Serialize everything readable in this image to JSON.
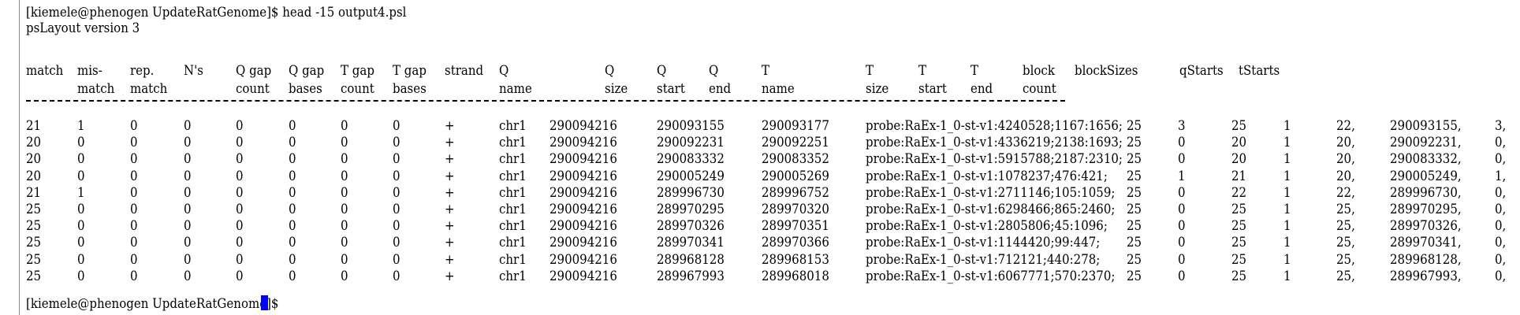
{
  "terminal": {
    "command_prompt": "[kiemele@phenogen UpdateRatGenome]$ head -15 output4.psl",
    "version_line": "psLayout version 3",
    "header_row1": [
      "match",
      "mis-",
      "rep.",
      "N's",
      "Q gap",
      "Q gap",
      "T gap",
      "T gap",
      "strand",
      "Q",
      "Q",
      "Q",
      "Q",
      "T",
      "T",
      "T",
      "T",
      "block",
      "blockSizes",
      "qStarts",
      "tStarts"
    ],
    "header_row2": [
      "",
      "match",
      "match",
      "",
      "count",
      "bases",
      "count",
      "bases",
      "",
      "name",
      "size",
      "start",
      "end",
      "name",
      "size",
      "start",
      "end",
      "count",
      "",
      "",
      ""
    ],
    "rows": [
      [
        "21",
        "1",
        "0",
        "0",
        "0",
        "0",
        "0",
        "0",
        "+",
        "chr1",
        "290094216",
        "290093155",
        "290093177",
        "probe:RaEx-1_0-st-v1:4240528;1167:1656;",
        "25",
        "3",
        "25",
        "1",
        "22,",
        "290093155,",
        "3,"
      ],
      [
        "20",
        "0",
        "0",
        "0",
        "0",
        "0",
        "0",
        "0",
        "+",
        "chr1",
        "290094216",
        "290092231",
        "290092251",
        "probe:RaEx-1_0-st-v1:4336219;2138:1693;",
        "25",
        "0",
        "20",
        "1",
        "20,",
        "290092231,",
        "0,"
      ],
      [
        "20",
        "0",
        "0",
        "0",
        "0",
        "0",
        "0",
        "0",
        "+",
        "chr1",
        "290094216",
        "290083332",
        "290083352",
        "probe:RaEx-1_0-st-v1:5915788;2187:2310;",
        "25",
        "0",
        "20",
        "1",
        "20,",
        "290083332,",
        "0,"
      ],
      [
        "20",
        "0",
        "0",
        "0",
        "0",
        "0",
        "0",
        "0",
        "+",
        "chr1",
        "290094216",
        "290005249",
        "290005269",
        "probe:RaEx-1_0-st-v1:1078237;476:421;",
        "25",
        "1",
        "21",
        "1",
        "20,",
        "290005249,",
        "1,"
      ],
      [
        "21",
        "1",
        "0",
        "0",
        "0",
        "0",
        "0",
        "0",
        "+",
        "chr1",
        "290094216",
        "289996730",
        "289996752",
        "probe:RaEx-1_0-st-v1:2711146;105:1059;",
        "25",
        "0",
        "22",
        "1",
        "22,",
        "289996730,",
        "0,"
      ],
      [
        "25",
        "0",
        "0",
        "0",
        "0",
        "0",
        "0",
        "0",
        "+",
        "chr1",
        "290094216",
        "289970295",
        "289970320",
        "probe:RaEx-1_0-st-v1:6298466;865:2460;",
        "25",
        "0",
        "25",
        "1",
        "25,",
        "289970295,",
        "0,"
      ],
      [
        "25",
        "0",
        "0",
        "0",
        "0",
        "0",
        "0",
        "0",
        "+",
        "chr1",
        "290094216",
        "289970326",
        "289970351",
        "probe:RaEx-1_0-st-v1:2805806;45:1096;",
        "25",
        "0",
        "25",
        "1",
        "25,",
        "289970326,",
        "0,"
      ],
      [
        "25",
        "0",
        "0",
        "0",
        "0",
        "0",
        "0",
        "0",
        "+",
        "chr1",
        "290094216",
        "289970341",
        "289970366",
        "probe:RaEx-1_0-st-v1:1144420;99:447;",
        "25",
        "0",
        "25",
        "1",
        "25,",
        "289970341,",
        "0,"
      ],
      [
        "25",
        "0",
        "0",
        "0",
        "0",
        "0",
        "0",
        "0",
        "+",
        "chr1",
        "290094216",
        "289968128",
        "289968153",
        "probe:RaEx-1_0-st-v1:712121;440:278;",
        "25",
        "0",
        "25",
        "1",
        "25,",
        "289968128,",
        "0,"
      ],
      [
        "25",
        "0",
        "0",
        "0",
        "0",
        "0",
        "0",
        "0",
        "+",
        "chr1",
        "290094216",
        "289967993",
        "289968018",
        "probe:RaEx-1_0-st-v1:6067771;570:2370;",
        "25",
        "0",
        "25",
        "1",
        "25,",
        "289967993,",
        "0,"
      ]
    ],
    "final_prompt": "[kiemele@phenogen UpdateRatGenome]$"
  }
}
